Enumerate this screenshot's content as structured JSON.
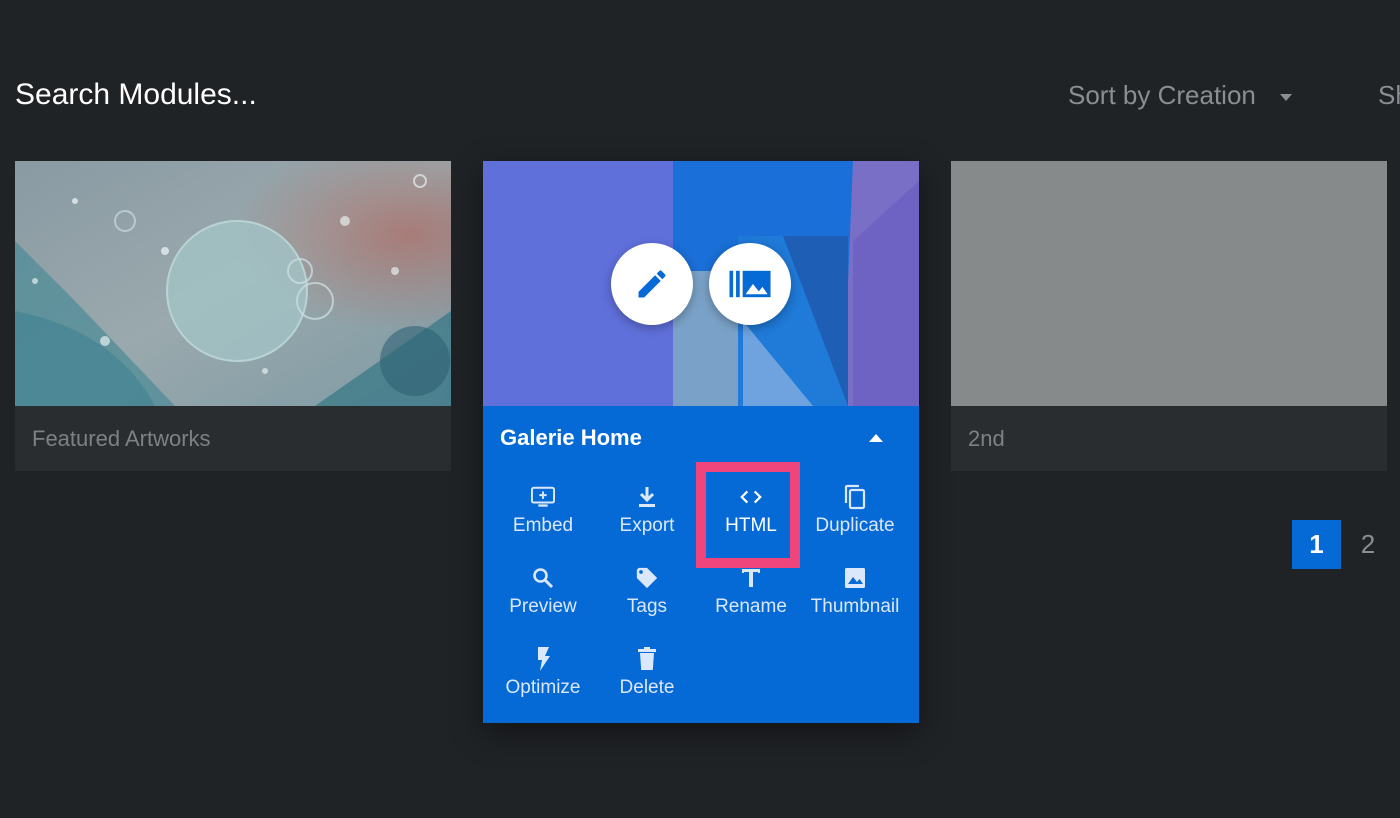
{
  "header": {
    "search_placeholder": "Search Modules...",
    "sort_label": "Sort by Creation",
    "cutoff_text": "Sh"
  },
  "cards": [
    {
      "title": "Featured Artworks"
    },
    {
      "title": "Galerie Home",
      "actions": [
        {
          "label": "Embed",
          "icon": "monitor-plus-icon"
        },
        {
          "label": "Export",
          "icon": "download-icon"
        },
        {
          "label": "HTML",
          "icon": "code-icon",
          "highlighted": true
        },
        {
          "label": "Duplicate",
          "icon": "copy-icon"
        },
        {
          "label": "Preview",
          "icon": "search-icon"
        },
        {
          "label": "Tags",
          "icon": "tag-icon"
        },
        {
          "label": "Rename",
          "icon": "text-icon"
        },
        {
          "label": "Thumbnail",
          "icon": "image-icon"
        },
        {
          "label": "Optimize",
          "icon": "bolt-icon"
        },
        {
          "label": "Delete",
          "icon": "trash-icon"
        }
      ]
    },
    {
      "title": "2nd"
    }
  ],
  "pagination": {
    "pages": [
      "1",
      "2"
    ],
    "current": "1"
  },
  "colors": {
    "background": "#202326",
    "accent": "#0569d6",
    "highlight": "#f0457c"
  }
}
